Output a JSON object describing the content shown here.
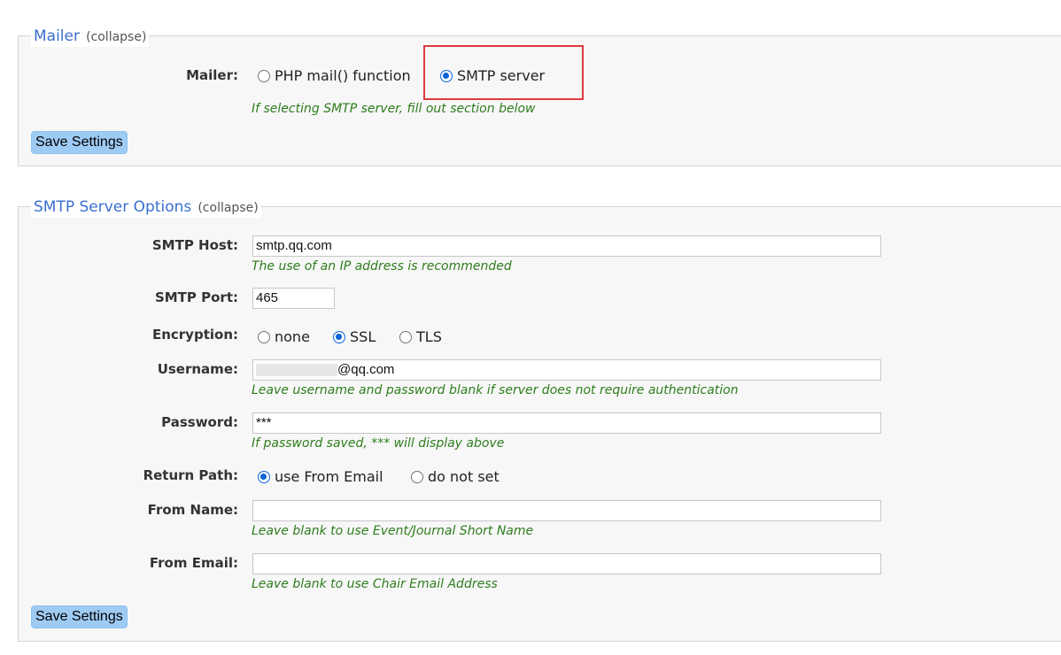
{
  "mailer_section": {
    "legend_title": "Mailer",
    "legend_collapse": "(collapse)",
    "mailer_label": "Mailer:",
    "options": [
      {
        "label": "PHP mail() function",
        "checked": false
      },
      {
        "label": "SMTP server",
        "checked": true
      }
    ],
    "hint": "If selecting SMTP server, fill out section below",
    "save_label": "Save Settings"
  },
  "smtp_section": {
    "legend_title": "SMTP Server Options",
    "legend_collapse": "(collapse)",
    "host": {
      "label": "SMTP Host:",
      "value": "smtp.qq.com",
      "hint": "The use of an IP address is recommended"
    },
    "port": {
      "label": "SMTP Port:",
      "value": "465"
    },
    "encryption": {
      "label": "Encryption:",
      "options": [
        {
          "label": "none",
          "checked": false
        },
        {
          "label": "SSL",
          "checked": true
        },
        {
          "label": "TLS",
          "checked": false
        }
      ]
    },
    "username": {
      "label": "Username:",
      "value_visible": "@qq.com",
      "hint": "Leave username and password blank if server does not require authentication"
    },
    "password": {
      "label": "Password:",
      "value": "***",
      "hint": "If password saved, *** will display above"
    },
    "return_path": {
      "label": "Return Path:",
      "options": [
        {
          "label": "use From Email",
          "checked": true
        },
        {
          "label": "do not set",
          "checked": false
        }
      ]
    },
    "from_name": {
      "label": "From Name:",
      "value": "",
      "hint": "Leave blank to use Event/Journal Short Name"
    },
    "from_email": {
      "label": "From Email:",
      "value": "",
      "hint": "Leave blank to use Chair Email Address"
    },
    "save_label": "Save Settings"
  },
  "colors": {
    "legend_title": "#3a6fd0",
    "hint_text": "#2e7d1d",
    "radio_checked": "#0b63d6",
    "button_bg": "#9ecbf4",
    "highlight_border": "#e0393e",
    "section_bg": "#f7f7f7"
  }
}
